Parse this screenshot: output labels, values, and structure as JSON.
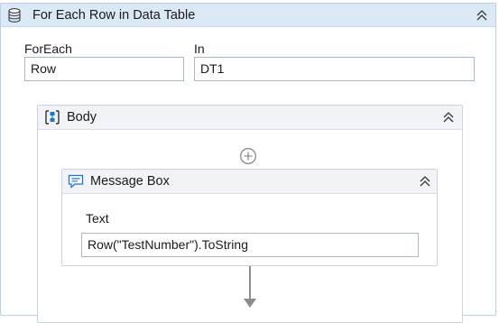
{
  "outer": {
    "title": "For Each Row in Data Table",
    "foreach_label": "ForEach",
    "foreach_value": "Row",
    "in_label": "In",
    "in_value": "DT1"
  },
  "body": {
    "title": "Body"
  },
  "message_box": {
    "title": "Message Box",
    "text_label": "Text",
    "text_value": "Row(\"TestNumber\").ToString"
  },
  "icons": {
    "outer": "database-icon",
    "body": "sequence-icon",
    "message_box": "message-box-icon",
    "add": "add-activity-icon",
    "collapse": "chevron-double-up-icon"
  },
  "colors": {
    "header_blue": "#dbe8f6",
    "border_blue": "#b9cfe6",
    "accent_blue": "#1c75d3"
  }
}
